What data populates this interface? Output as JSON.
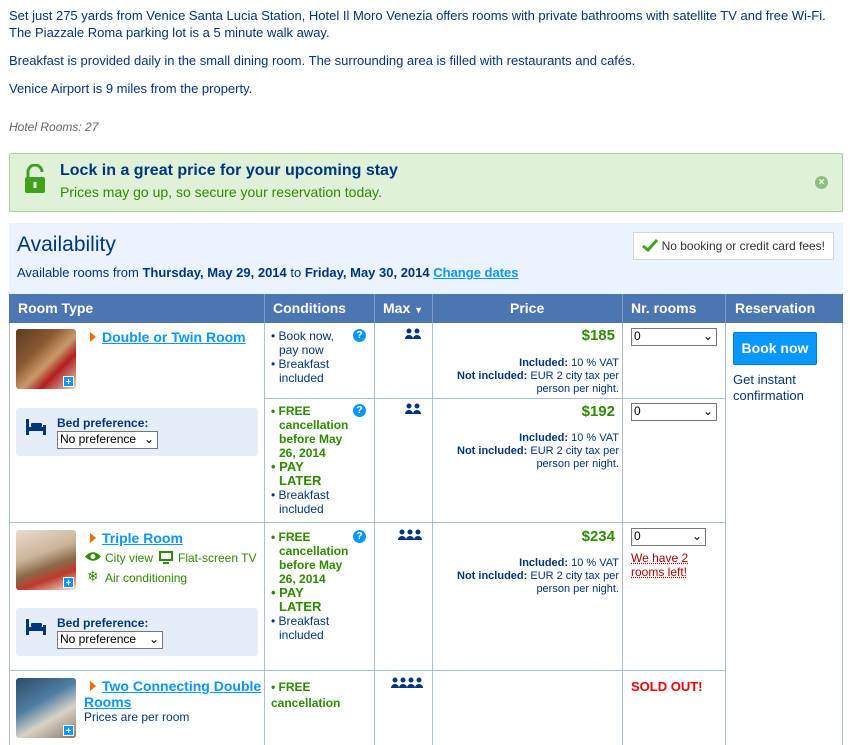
{
  "intro": {
    "p1": "Set just 275 yards from Venice Santa Lucia Station, Hotel Il Moro Venezia offers rooms with private bathrooms with satellite TV and free Wi-Fi. The Piazzale Roma parking lot is a 5 minute walk away.",
    "p2": "Breakfast is provided daily in the small dining room. The surrounding area is filled with restaurants and cafés.",
    "p3": "Venice Airport is 9 miles from the property.",
    "hotel_rooms": "Hotel Rooms: 27"
  },
  "lock": {
    "title": "Lock in a great price for your upcoming stay",
    "subtitle": "Prices may go up, so secure your reservation today.",
    "close": "×"
  },
  "availability": {
    "title": "Availability",
    "prefix": "Available rooms from ",
    "from": "Thursday, May 29, 2014",
    "to_word": " to ",
    "to": "Friday, May 30, 2014",
    "change": "Change dates",
    "no_fees": "No booking or credit card fees!"
  },
  "table": {
    "headers": {
      "room_type": "Room Type",
      "conditions": "Conditions",
      "max": "Max",
      "price": "Price",
      "nr_rooms": "Nr. rooms",
      "reservation": "Reservation"
    }
  },
  "rooms": {
    "r1": {
      "name": "Double or Twin Room",
      "bed_label": "Bed preference:",
      "bed_value": "No preference",
      "rate1": {
        "l1": "• Book now,",
        "l2": "pay now",
        "l3": "• Breakfast",
        "l4": "included",
        "price": "$185",
        "qty": "0"
      },
      "rate2": {
        "l1": "• FREE",
        "l2": "cancellation",
        "l3": "before May",
        "l4": "26, 2014",
        "l5": "• PAY",
        "l6": "LATER",
        "l7": "• Breakfast",
        "l8": "included",
        "price": "$192",
        "qty": "0"
      }
    },
    "r2": {
      "name": "Triple Room",
      "feat1": "City view",
      "feat2": "Flat-screen TV",
      "feat3": "Air conditioning",
      "bed_label": "Bed preference:",
      "bed_value": "No preference",
      "rate1": {
        "l1": "• FREE",
        "l2": "cancellation",
        "l3": "before May",
        "l4": "26, 2014",
        "l5": "• PAY",
        "l6": "LATER",
        "l7": "• Breakfast",
        "l8": "included",
        "price": "$234",
        "qty": "0",
        "warn1": "We have 2",
        "warn2": "rooms left!"
      }
    },
    "r3": {
      "name1": "Two Connecting Double",
      "name2": "Rooms",
      "sub": "Prices are per room",
      "l1": "• FREE",
      "l2": "cancellation",
      "sold": "SOLD OUT!"
    }
  },
  "tax": {
    "inc_label": "Included:",
    "inc_val": " 10 % VAT",
    "not_label": "Not included:",
    "not_val": " EUR 2 city tax per",
    "not_val2": "person per night."
  },
  "reservation": {
    "book": "Book now",
    "instant1": "Get instant",
    "instant2": "confirmation"
  }
}
